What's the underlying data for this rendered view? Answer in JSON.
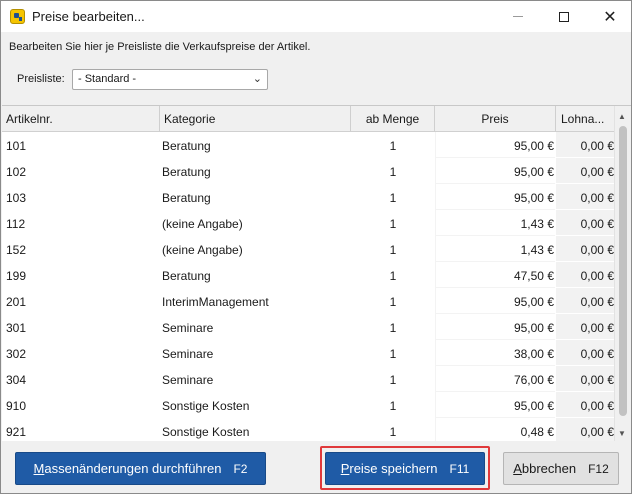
{
  "window": {
    "title": "Preise bearbeiten...",
    "min_icon": "minimize-icon",
    "max_icon": "maximize-icon",
    "close_icon": "close-icon",
    "close_glyph": "✕"
  },
  "intro_text": "Bearbeiten Sie hier je Preisliste die Verkaufspreise der Artikel.",
  "preisliste": {
    "label": "Preisliste:",
    "selected": "- Standard -"
  },
  "table": {
    "columns": [
      "Artikelnr.",
      "Kategorie",
      "ab Menge",
      "Preis",
      "Lohna..."
    ],
    "rows": [
      {
        "art": "101",
        "cat": "Beratung",
        "qty": "1",
        "price": "95,00 €",
        "lohn": "0,00 €"
      },
      {
        "art": "102",
        "cat": "Beratung",
        "qty": "1",
        "price": "95,00 €",
        "lohn": "0,00 €"
      },
      {
        "art": "103",
        "cat": "Beratung",
        "qty": "1",
        "price": "95,00 €",
        "lohn": "0,00 €"
      },
      {
        "art": "112",
        "cat": "(keine Angabe)",
        "qty": "1",
        "price": "1,43 €",
        "lohn": "0,00 €"
      },
      {
        "art": "152",
        "cat": "(keine Angabe)",
        "qty": "1",
        "price": "1,43 €",
        "lohn": "0,00 €"
      },
      {
        "art": "199",
        "cat": "Beratung",
        "qty": "1",
        "price": "47,50 €",
        "lohn": "0,00 €"
      },
      {
        "art": "201",
        "cat": "InterimManagement",
        "qty": "1",
        "price": "95,00 €",
        "lohn": "0,00 €"
      },
      {
        "art": "301",
        "cat": "Seminare",
        "qty": "1",
        "price": "95,00 €",
        "lohn": "0,00 €"
      },
      {
        "art": "302",
        "cat": "Seminare",
        "qty": "1",
        "price": "38,00 €",
        "lohn": "0,00 €"
      },
      {
        "art": "304",
        "cat": "Seminare",
        "qty": "1",
        "price": "76,00 €",
        "lohn": "0,00 €"
      },
      {
        "art": "910",
        "cat": "Sonstige Kosten",
        "qty": "1",
        "price": "95,00 €",
        "lohn": "0,00 €"
      },
      {
        "art": "921",
        "cat": "Sonstige Kosten",
        "qty": "1",
        "price": "0,48 €",
        "lohn": "0,00 €"
      }
    ]
  },
  "buttons": {
    "mass": {
      "first": "M",
      "rest": "assenänderungen durchführen",
      "key": "F2"
    },
    "save": {
      "first": "P",
      "rest": "reise speichern",
      "key": "F11"
    },
    "cancel": {
      "first": "A",
      "rest": "bbrechen",
      "key": "F12"
    }
  },
  "colors": {
    "primary_button": "#1f5ba6",
    "highlight_frame": "#e0393b"
  }
}
